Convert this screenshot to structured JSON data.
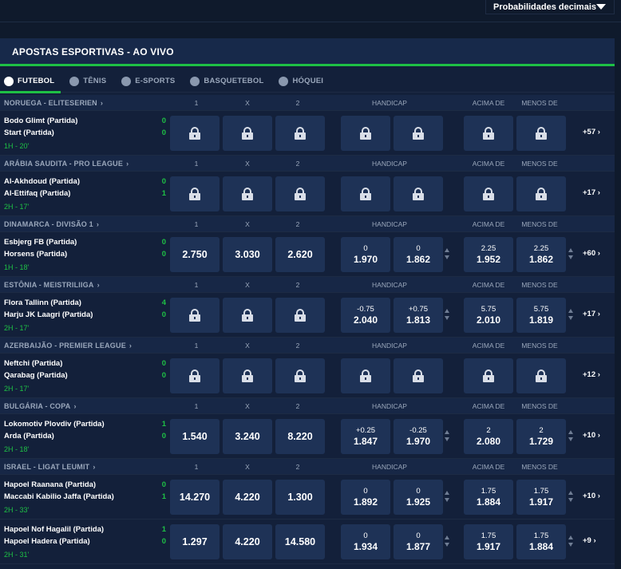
{
  "top": {
    "odds_format_label": "Probabilidades decimais"
  },
  "section_title": "APOSTAS ESPORTIVAS - AO VIVO",
  "tabs": [
    {
      "label": "FUTEBOL",
      "icon": "soccer-ball-icon",
      "active": true
    },
    {
      "label": "TÊNIS",
      "icon": "tennis-ball-icon",
      "active": false
    },
    {
      "label": "E-SPORTS",
      "icon": "gamepad-icon",
      "active": false
    },
    {
      "label": "BASQUETEBOL",
      "icon": "basketball-icon",
      "active": false
    },
    {
      "label": "HÓQUEI",
      "icon": "hockey-puck-icon",
      "active": false
    }
  ],
  "columns": {
    "one": "1",
    "x": "X",
    "two": "2",
    "handicap": "HANDICAP",
    "over": "ACIMA DE",
    "under": "MENOS DE"
  },
  "leagues": [
    {
      "name": "NORUEGA - ELITESERIEN",
      "matches": [
        {
          "home": "Bodo Glimt (Partida)",
          "away": "Start (Partida)",
          "home_score": "0",
          "away_score": "0",
          "time": "1H - 20'",
          "locked": true,
          "more": "+57"
        }
      ]
    },
    {
      "name": "ARÁBIA SAUDITA - PRO LEAGUE",
      "matches": [
        {
          "home": "Al-Akhdoud (Partida)",
          "away": "Al-Ettifaq (Partida)",
          "home_score": "0",
          "away_score": "1",
          "time": "2H - 17'",
          "locked": true,
          "more": "+17"
        }
      ]
    },
    {
      "name": "DINAMARCA - DIVISÃO 1",
      "matches": [
        {
          "home": "Esbjerg FB (Partida)",
          "away": "Horsens (Partida)",
          "home_score": "0",
          "away_score": "0",
          "time": "1H - 18'",
          "locked": false,
          "odds": [
            "2.750",
            "3.030",
            "2.620"
          ],
          "handicap": [
            [
              "0",
              "1.970"
            ],
            [
              "0",
              "1.862"
            ]
          ],
          "totals": [
            [
              "2.25",
              "1.952"
            ],
            [
              "2.25",
              "1.862"
            ]
          ],
          "more": "+60"
        }
      ]
    },
    {
      "name": "ESTÔNIA - MEISTRILIIGA",
      "matches": [
        {
          "home": "Flora Tallinn (Partida)",
          "away": "Harju JK Laagri (Partida)",
          "home_score": "4",
          "away_score": "0",
          "time": "2H - 17'",
          "locked": false,
          "odds_locked": true,
          "handicap": [
            [
              "-0.75",
              "2.040"
            ],
            [
              "+0.75",
              "1.813"
            ]
          ],
          "totals": [
            [
              "5.75",
              "2.010"
            ],
            [
              "5.75",
              "1.819"
            ]
          ],
          "more": "+17"
        }
      ]
    },
    {
      "name": "AZERBAIJÃO - PREMIER LEAGUE",
      "matches": [
        {
          "home": "Neftchi (Partida)",
          "away": "Qarabag (Partida)",
          "home_score": "0",
          "away_score": "0",
          "time": "2H - 17'",
          "locked": true,
          "more": "+12"
        }
      ]
    },
    {
      "name": "BULGÁRIA - COPA",
      "matches": [
        {
          "home": "Lokomotiv Plovdiv (Partida)",
          "away": "Arda (Partida)",
          "home_score": "1",
          "away_score": "0",
          "time": "2H - 18'",
          "locked": false,
          "odds": [
            "1.540",
            "3.240",
            "8.220"
          ],
          "handicap": [
            [
              "+0.25",
              "1.847"
            ],
            [
              "-0.25",
              "1.970"
            ]
          ],
          "totals": [
            [
              "2",
              "2.080"
            ],
            [
              "2",
              "1.729"
            ]
          ],
          "more": "+10"
        }
      ]
    },
    {
      "name": "ISRAEL - LIGAT LEUMIT",
      "matches": [
        {
          "home": "Hapoel Raanana (Partida)",
          "away": "Maccabi Kabilio Jaffa (Partida)",
          "home_score": "0",
          "away_score": "1",
          "time": "2H - 33'",
          "locked": false,
          "odds": [
            "14.270",
            "4.220",
            "1.300"
          ],
          "handicap": [
            [
              "0",
              "1.892"
            ],
            [
              "0",
              "1.925"
            ]
          ],
          "totals": [
            [
              "1.75",
              "1.884"
            ],
            [
              "1.75",
              "1.917"
            ]
          ],
          "more": "+10"
        },
        {
          "home": "Hapoel Nof Hagalil (Partida)",
          "away": "Hapoel Hadera (Partida)",
          "home_score": "1",
          "away_score": "0",
          "time": "2H - 31'",
          "locked": false,
          "odds": [
            "1.297",
            "4.220",
            "14.580"
          ],
          "handicap": [
            [
              "0",
              "1.934"
            ],
            [
              "0",
              "1.877"
            ]
          ],
          "totals": [
            [
              "1.75",
              "1.917"
            ],
            [
              "1.75",
              "1.884"
            ]
          ],
          "more": "+9"
        }
      ]
    }
  ]
}
